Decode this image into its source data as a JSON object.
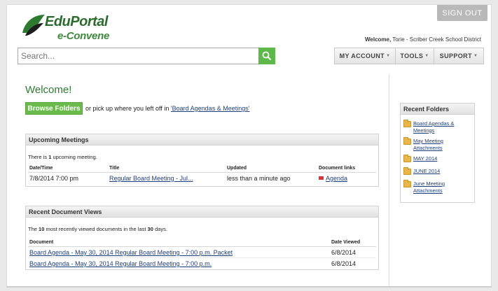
{
  "header": {
    "sign_out_label": "SIGN OUT",
    "logo_text": "EduPortal",
    "logo_sub": "e-Convene",
    "welcome_prefix": "Welcome,",
    "welcome_user": "Torie - Scriber Creek School District"
  },
  "search": {
    "placeholder": "Search...",
    "icon": "search-icon"
  },
  "nav": {
    "items": [
      {
        "label": "MY ACCOUNT"
      },
      {
        "label": "TOOLS"
      },
      {
        "label": "SUPPORT"
      }
    ]
  },
  "main": {
    "title": "Welcome!",
    "browse_button": "Browse Folders",
    "pickup_text": "or pick up where you left off in",
    "pickup_link": "'Board Agendas & Meetings'"
  },
  "upcoming": {
    "heading": "Upcoming Meetings",
    "summary_pre": "There is",
    "summary_count": "1",
    "summary_post": "upcoming meeting.",
    "columns": [
      "Date/Time",
      "Title",
      "Updated",
      "Document links"
    ],
    "rows": [
      {
        "datetime": "7/8/2014 7:00 pm",
        "title": "Regular Board Meeting - Jul...",
        "updated": "less than a minute ago",
        "doc": "Agenda"
      }
    ]
  },
  "recent_docs": {
    "heading": "Recent Document Views",
    "summary_pre": "The",
    "summary_count": "10",
    "summary_mid": "most recently viewed documents in the last",
    "summary_days": "30",
    "summary_post": "days.",
    "columns": [
      "Document",
      "Date Viewed"
    ],
    "rows": [
      {
        "document": "Board Agenda - May 30, 2014 Regular Board Meeting - 7:00 p.m. Packet",
        "date": "6/8/2014"
      },
      {
        "document": "Board Agenda - May 30, 2014 Regular Board Meeting - 7:00 p.m.",
        "date": "6/8/2014"
      }
    ]
  },
  "recent_folders": {
    "heading": "Recent Folders",
    "items": [
      {
        "label": "Board Agendas & Meetings"
      },
      {
        "label": "May Meeting Attachments"
      },
      {
        "label": "MAY 2014"
      },
      {
        "label": "JUNE 2014"
      },
      {
        "label": "June Meeting Attachments"
      }
    ]
  },
  "colors": {
    "brand_green": "#6bbb4c",
    "link_blue": "#1f3f7a",
    "title_green": "#2f7a31"
  }
}
